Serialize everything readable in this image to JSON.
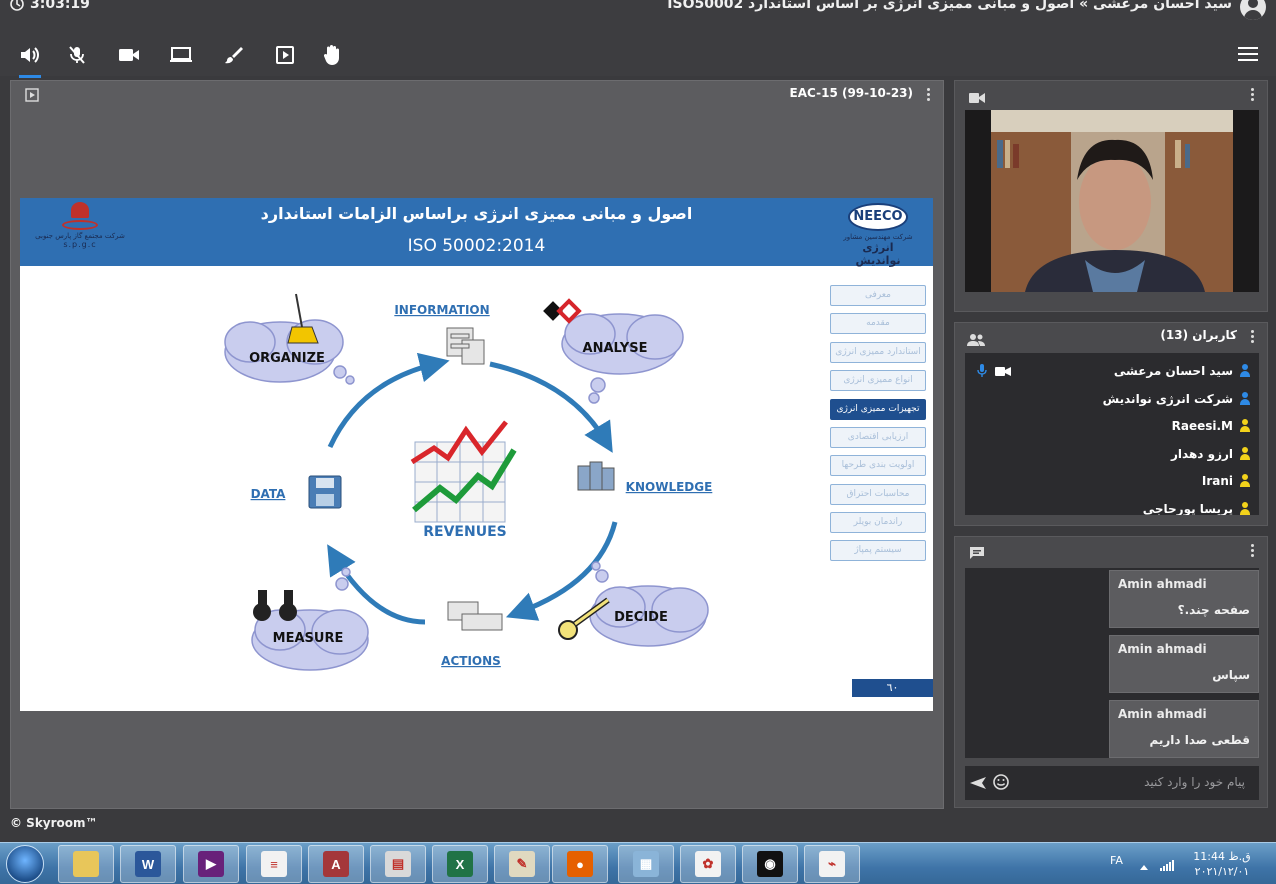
{
  "header": {
    "timer": "3:03:19",
    "session_title": "سید احسان مرعشی » اصول و مبانی ممیزی انرژی بر اساس استاندارد ISO50002"
  },
  "toolbar": {
    "items": [
      "speaker-icon",
      "mic-muted-icon",
      "camera-icon",
      "screen-share-icon",
      "whiteboard-brush-icon",
      "presentation-icon",
      "raise-hand-icon"
    ],
    "active": "speaker-icon"
  },
  "presentation": {
    "file_title": "EAC-15 (99-10-23)",
    "slide": {
      "title": "اصول و مبانی ممیزی انرژی براساس الزامات استاندارد",
      "subtitle": "ISO 50002:2014",
      "logo_right": {
        "name": "NEECO",
        "sub": "شرکت مهندسین مشاور",
        "org": "انرژی نواندیش"
      },
      "logo_left": {
        "org": "شرکت مجتمع گاز پارس جنوبی",
        "abbr": "s.p.g.c"
      },
      "side_menu": [
        "معرفی",
        "مقدمه",
        "استاندارد ممیزی انرژی",
        "انواع ممیزی انرژی",
        "تجهیزات ممیزی انرژی",
        "ارزیابی اقتصادی",
        "اولویت بندی طرحها",
        "محاسبات احتراق",
        "راندمان بویلر",
        "سیستم پمپاژ"
      ],
      "side_menu_active": 4,
      "page_number": "٦٠",
      "cycle": {
        "information": "INFORMATION",
        "analyse": "ANALYSE",
        "knowledge": "KNOWLEDGE",
        "decide": "DECIDE",
        "actions": "ACTIONS",
        "measure": "MEASURE",
        "data": "DATA",
        "organize": "ORGANIZE",
        "revenues": "REVENUES"
      }
    }
  },
  "users": {
    "title": "کاربران (13)",
    "list": [
      {
        "name": "سید احسان مرعشی",
        "color": "#2e8ae6",
        "mic": true,
        "cam": true
      },
      {
        "name": "شرکت انرژی نواندیش",
        "color": "#2e8ae6",
        "mic": false,
        "cam": false
      },
      {
        "name": "Raeesi.M",
        "color": "#f2d21b",
        "mic": false,
        "cam": false
      },
      {
        "name": "ارزو دهدار",
        "color": "#f2d21b",
        "mic": false,
        "cam": false
      },
      {
        "name": "Irani",
        "color": "#f2d21b",
        "mic": false,
        "cam": false
      },
      {
        "name": "پریسا پورحاجی",
        "color": "#f2d21b",
        "mic": false,
        "cam": false
      }
    ]
  },
  "chat": {
    "messages": [
      {
        "author": "Amin ahmadi",
        "text": "صفحه چند.؟"
      },
      {
        "author": "Amin ahmadi",
        "text": "سپاس"
      },
      {
        "author": "Amin ahmadi",
        "text": "قطعی صدا داریم"
      }
    ],
    "placeholder": "پیام خود را وارد کنید"
  },
  "footer": {
    "copyright": "© Skyroom™"
  },
  "taskbar": {
    "apps": [
      "file-explorer",
      "word",
      "visual-studio",
      "notepad-doc",
      "access",
      "fax-printer",
      "excel",
      "paint",
      "firefox",
      "control-panel",
      "color-app",
      "recorder",
      "acrobat"
    ],
    "active_app": "acrobat",
    "lang": "FA",
    "time": "ق.ظ 11:44",
    "date": "۲۰۲۱/۱۲/۰۱"
  }
}
